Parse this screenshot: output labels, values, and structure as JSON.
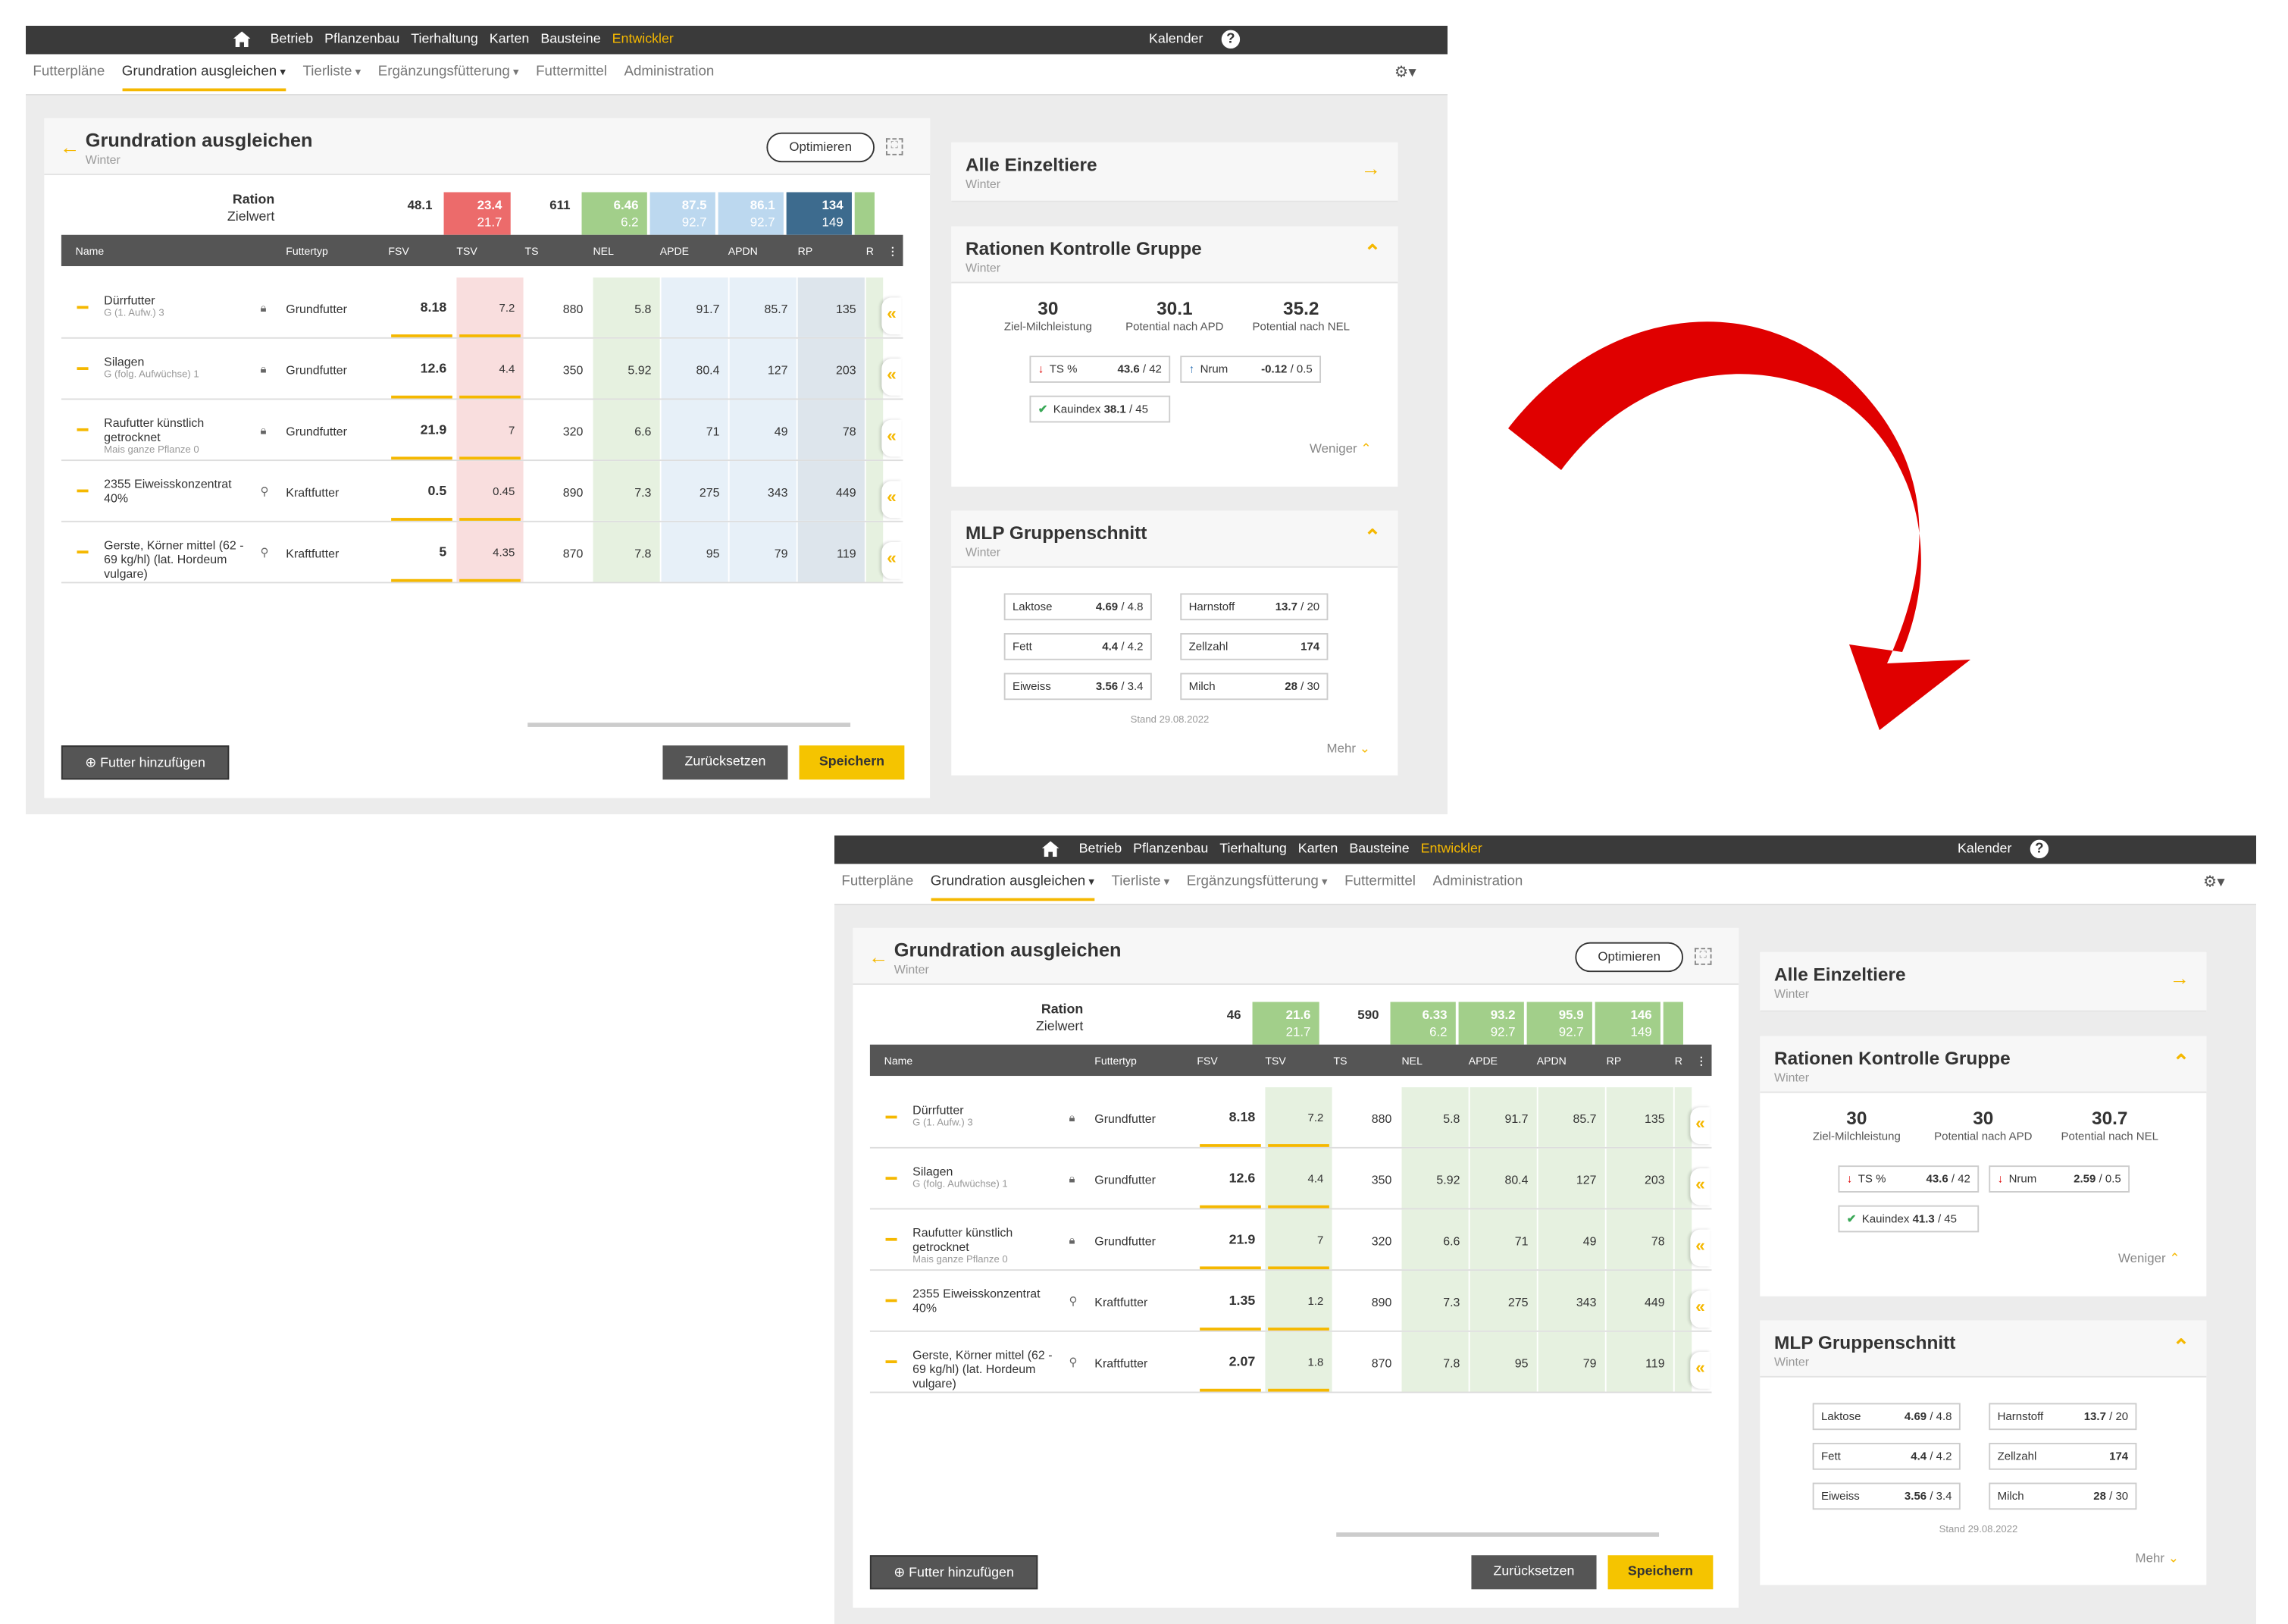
{
  "nav": {
    "items": [
      "Betrieb",
      "Pflanzenbau",
      "Tierhaltung",
      "Karten",
      "Bausteine"
    ],
    "dev": "Entwickler",
    "calendar": "Kalender",
    "help": "?"
  },
  "subnav": {
    "items": [
      "Futterpläne",
      "Grundration ausgleichen",
      "Tierliste",
      "Ergänzungsfütterung",
      "Futtermittel",
      "Administration"
    ]
  },
  "panel": {
    "title": "Grundration ausgleichen",
    "subtitle": "Winter",
    "optimize": "Optimieren",
    "ration": "Ration",
    "zielwert": "Zielwert"
  },
  "columns": [
    "Name",
    "Futtertyp",
    "FSV",
    "TSV",
    "TS",
    "NEL",
    "APDE",
    "APDN",
    "RP",
    "R"
  ],
  "rows": [
    {
      "name": "Dürrfutter",
      "sub": "G (1. Aufw.) 3",
      "typ": "Grundfutter",
      "ts": "880",
      "nel": "5.8",
      "apde": "91.7",
      "apdn": "85.7",
      "rp": "135"
    },
    {
      "name": "Silagen",
      "sub": "G (folg. Aufwüchse) 1",
      "typ": "Grundfutter",
      "ts": "350",
      "nel": "5.92",
      "apde": "80.4",
      "apdn": "127",
      "rp": "203"
    },
    {
      "name": "Raufutter künstlich getrocknet",
      "sub": "Mais ganze Pflanze 0",
      "typ": "Grundfutter",
      "ts": "320",
      "nel": "6.6",
      "apde": "71",
      "apdn": "49",
      "rp": "78"
    },
    {
      "name": "2355 Eiweisskonzentrat 40%",
      "sub": "",
      "typ": "Kraftfutter",
      "ts": "890",
      "nel": "7.3",
      "apde": "275",
      "apdn": "343",
      "rp": "449"
    },
    {
      "name": "Gerste, Körner mittel (62 - 69 kg/hl) (lat. Hordeum vulgare)",
      "sub": "",
      "typ": "Kraftfutter",
      "ts": "870",
      "nel": "7.8",
      "apde": "95",
      "apdn": "79",
      "rp": "119"
    }
  ],
  "buttons": {
    "add": "Futter hinzufügen",
    "reset": "Zurücksetzen",
    "save": "Speichern"
  },
  "cards": {
    "alle": {
      "title": "Alle Einzeltiere",
      "subtitle": "Winter"
    },
    "kontrolle": {
      "title": "Rationen Kontrolle Gruppe",
      "subtitle": "Winter",
      "labels": [
        "Ziel-Milchleistung",
        "Potential nach APD",
        "Potential nach NEL"
      ],
      "ts_label": "TS %",
      "nrum_label": "Nrum",
      "kau_label": "Kauindex",
      "less": "Weniger"
    },
    "mlp": {
      "title": "MLP Gruppenschnitt",
      "subtitle": "Winter",
      "items": [
        {
          "label": "Laktose",
          "val": "4.69",
          "tgt": " / 4.8"
        },
        {
          "label": "Harnstoff",
          "val": "13.7",
          "tgt": " / 20"
        },
        {
          "label": "Fett",
          "val": "4.4",
          "tgt": " / 4.2"
        },
        {
          "label": "Zellzahl",
          "val": "174",
          "tgt": ""
        },
        {
          "label": "Eiweiss",
          "val": "3.56",
          "tgt": " / 3.4"
        },
        {
          "label": "Milch",
          "val": "28",
          "tgt": " / 30"
        }
      ],
      "stand": "Stand 29.08.2022",
      "more": "Mehr"
    }
  },
  "before": {
    "summary": {
      "fsv": "48.1",
      "tsv": "23.4",
      "tsv_t": "21.7",
      "ts": "611",
      "nel": "6.46",
      "nel_t": "6.2",
      "apde": "87.5",
      "apde_t": "92.7",
      "apdn": "86.1",
      "apdn_t": "92.7",
      "rp": "134",
      "rp_t": "149"
    },
    "fsv": [
      "8.18",
      "12.6",
      "21.9",
      "0.5",
      "5"
    ],
    "tsv": [
      "7.2",
      "4.4",
      "7",
      "0.45",
      "4.35"
    ],
    "kpi": [
      "30",
      "30.1",
      "35.2"
    ],
    "ts_val": "43.6",
    "ts_tgt": " / 42",
    "nrum_val": "-0.12",
    "nrum_tgt": " / 0.5",
    "kau_val": "38.1",
    "kau_tgt": " / 45",
    "colors": {
      "tsv_head": "#ec6b6b",
      "tsv_cells": "#f9dede",
      "nel_head": "#a2cf8a",
      "apd_head": "#bcd8ef",
      "rp_head": "#3d6b8e",
      "nel_cells": "#e6f1e0",
      "apd_cells": "#e7f0f8",
      "rp_cells": "#dde5ec"
    }
  },
  "after": {
    "summary": {
      "fsv": "46",
      "tsv": "21.6",
      "tsv_t": "21.7",
      "ts": "590",
      "nel": "6.33",
      "nel_t": "6.2",
      "apde": "93.2",
      "apde_t": "92.7",
      "apdn": "95.9",
      "apdn_t": "92.7",
      "rp": "146",
      "rp_t": "149"
    },
    "fsv": [
      "8.18",
      "12.6",
      "21.9",
      "1.35",
      "2.07"
    ],
    "tsv": [
      "7.2",
      "4.4",
      "7",
      "1.2",
      "1.8"
    ],
    "kpi": [
      "30",
      "30",
      "30.7"
    ],
    "ts_val": "43.6",
    "ts_tgt": " / 42",
    "nrum_val": "2.59",
    "nrum_tgt": " / 0.5",
    "kau_val": "41.3",
    "kau_tgt": " / 45",
    "colors": {
      "tsv_head": "#a2cf8a",
      "tsv_cells": "#e6f1e0",
      "nel_head": "#a2cf8a",
      "apd_head": "#a2cf8a",
      "rp_head": "#a2cf8a",
      "nel_cells": "#e6f1e0",
      "apd_cells": "#e6f1e0",
      "rp_cells": "#e6f1e0"
    }
  },
  "arrow_color": "#e00000"
}
